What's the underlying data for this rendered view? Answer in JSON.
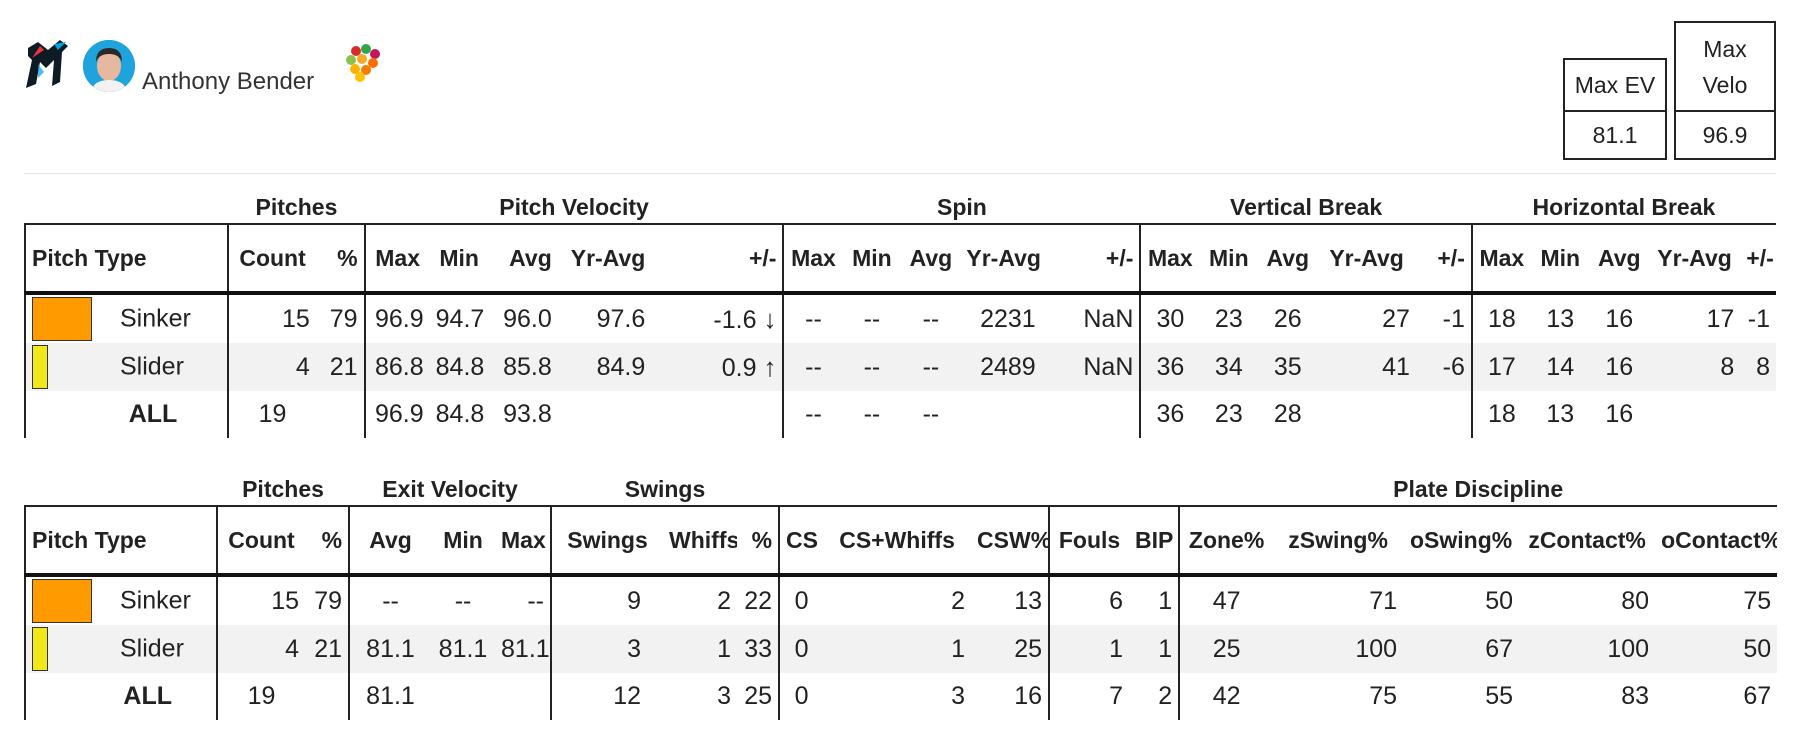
{
  "player": {
    "name": "Anthony Bender",
    "team_logo": "marlins-logo",
    "avatar": "player-headshot",
    "color_icon": "multicolor-dots-icon"
  },
  "summary": {
    "max_ev_label": "Max EV",
    "max_ev_value": "81.1",
    "max_velo_label_1": "Max",
    "max_velo_label_2": "Velo",
    "max_velo_value": "96.9"
  },
  "pitch_table": {
    "groups": {
      "pitches": "Pitches",
      "velocity": "Pitch Velocity",
      "spin": "Spin",
      "vbreak": "Vertical Break",
      "hbreak": "Horizontal Break"
    },
    "columns": [
      "Pitch Type",
      "Count",
      "%",
      "Max",
      "Min",
      "Avg",
      "Yr-Avg",
      "+/-",
      "Max",
      "Min",
      "Avg",
      "Yr-Avg",
      "+/-",
      "Max",
      "Min",
      "Avg",
      "Yr-Avg",
      "+/-",
      "Max",
      "Min",
      "Avg",
      "Yr-Avg",
      "+/-"
    ],
    "rows": [
      {
        "name": "Sinker",
        "color": "#ff9a00",
        "count": "15",
        "pct": "79",
        "v_max": "96.9",
        "v_min": "94.7",
        "v_avg": "96.0",
        "v_yr": "97.6",
        "v_diff": "-1.6",
        "v_arrow": "↓",
        "s_max": "--",
        "s_min": "--",
        "s_avg": "--",
        "s_yr": "2231",
        "s_diff": "NaN",
        "vb_max": "30",
        "vb_min": "23",
        "vb_avg": "26",
        "vb_yr": "27",
        "vb_diff": "-1",
        "hb_max": "18",
        "hb_min": "13",
        "hb_avg": "16",
        "hb_yr": "17",
        "hb_diff": "-1"
      },
      {
        "name": "Slider",
        "color": "#f0e81a",
        "count": "4",
        "pct": "21",
        "v_max": "86.8",
        "v_min": "84.8",
        "v_avg": "85.8",
        "v_yr": "84.9",
        "v_diff": "0.9",
        "v_arrow": "↑",
        "s_max": "--",
        "s_min": "--",
        "s_avg": "--",
        "s_yr": "2489",
        "s_diff": "NaN",
        "vb_max": "36",
        "vb_min": "34",
        "vb_avg": "35",
        "vb_yr": "41",
        "vb_diff": "-6",
        "hb_max": "17",
        "hb_min": "14",
        "hb_avg": "16",
        "hb_yr": "8",
        "hb_diff": "8"
      },
      {
        "name": "ALL",
        "count": "19",
        "pct": "",
        "v_max": "96.9",
        "v_min": "84.8",
        "v_avg": "93.8",
        "v_yr": "",
        "v_diff": "",
        "v_arrow": "",
        "s_max": "--",
        "s_min": "--",
        "s_avg": "--",
        "s_yr": "",
        "s_diff": "",
        "vb_max": "36",
        "vb_min": "23",
        "vb_avg": "28",
        "vb_yr": "",
        "vb_diff": "",
        "hb_max": "18",
        "hb_min": "13",
        "hb_avg": "16",
        "hb_yr": "",
        "hb_diff": ""
      }
    ]
  },
  "contact_table": {
    "groups": {
      "pitches": "Pitches",
      "ev": "Exit Velocity",
      "swings": "Swings",
      "plate": "Plate Discipline"
    },
    "columns": [
      "Pitch Type",
      "Count",
      "%",
      "Avg",
      "Min",
      "Max",
      "Swings",
      "Whiffs",
      "%",
      "CS",
      "CS+Whiffs",
      "CSW%",
      "Fouls",
      "BIP",
      "Zone%",
      "zSwing%",
      "oSwing%",
      "zContact%",
      "oContact%"
    ],
    "rows": [
      {
        "name": "Sinker",
        "color": "#ff9a00",
        "count": "15",
        "pct": "79",
        "ev_avg": "--",
        "ev_min": "--",
        "ev_max": "--",
        "swings": "9",
        "whiffs": "2",
        "whiff_pct": "22",
        "cs": "0",
        "cs_whiffs": "2",
        "csw": "13",
        "fouls": "6",
        "bip": "1",
        "zone": "47",
        "zswing": "71",
        "oswing": "50",
        "zcontact": "80",
        "ocontact": "75"
      },
      {
        "name": "Slider",
        "color": "#f0e81a",
        "count": "4",
        "pct": "21",
        "ev_avg": "81.1",
        "ev_min": "81.1",
        "ev_max": "81.1",
        "swings": "3",
        "whiffs": "1",
        "whiff_pct": "33",
        "cs": "0",
        "cs_whiffs": "1",
        "csw": "25",
        "fouls": "1",
        "bip": "1",
        "zone": "25",
        "zswing": "100",
        "oswing": "67",
        "zcontact": "100",
        "ocontact": "50"
      },
      {
        "name": "ALL",
        "count": "19",
        "pct": "",
        "ev_avg": "81.1",
        "ev_min": "",
        "ev_max": "",
        "swings": "12",
        "whiffs": "3",
        "whiff_pct": "25",
        "cs": "0",
        "cs_whiffs": "3",
        "csw": "16",
        "fouls": "7",
        "bip": "2",
        "zone": "42",
        "zswing": "75",
        "oswing": "55",
        "zcontact": "83",
        "ocontact": "67"
      }
    ]
  }
}
